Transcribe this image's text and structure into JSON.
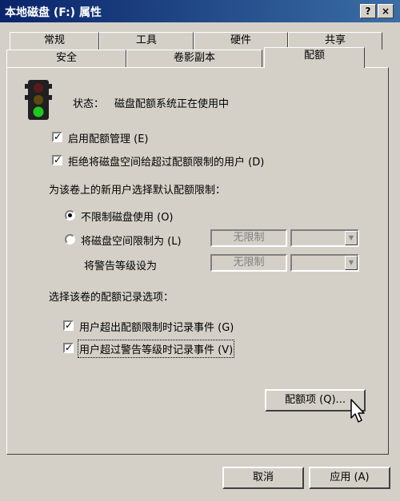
{
  "window": {
    "title": "本地磁盘 (F:) 属性",
    "help_label": "?",
    "close_label": "×"
  },
  "tabs": {
    "row1": [
      "常规",
      "工具",
      "硬件",
      "共享"
    ],
    "row2": [
      "安全",
      "卷影副本",
      "配额"
    ],
    "active": "配额"
  },
  "status": {
    "label": "状态：",
    "text": "磁盘配额系统正在使用中"
  },
  "options": {
    "enable_quota": {
      "label": "启用配额管理 (E)",
      "checked": true
    },
    "deny_space": {
      "label": "拒绝将磁盘空间给超过配额限制的用户 (D)",
      "checked": true
    }
  },
  "defaults": {
    "heading": "为该卷上的新用户选择默认配额限制：",
    "no_limit": "不限制磁盘使用 (O)",
    "limit_space": "将磁盘空间限制为 (L)",
    "limit_value": "无限制",
    "warning_label": "将警告等级设为",
    "warning_value": "无限制"
  },
  "logging": {
    "heading": "选择该卷的配额记录选项：",
    "log_over_limit": {
      "label": "用户超出配额限制时记录事件 (G)",
      "checked": true
    },
    "log_over_warning": {
      "label": "用户超过警告等级时记录事件 (V)",
      "checked": true
    }
  },
  "buttons": {
    "quota_entries": "配额项 (Q)...",
    "cancel": "取消",
    "apply": "应用 (A)"
  },
  "icons": {
    "traffic_light": "traffic-light-icon",
    "cursor": "mouse-cursor-icon"
  }
}
